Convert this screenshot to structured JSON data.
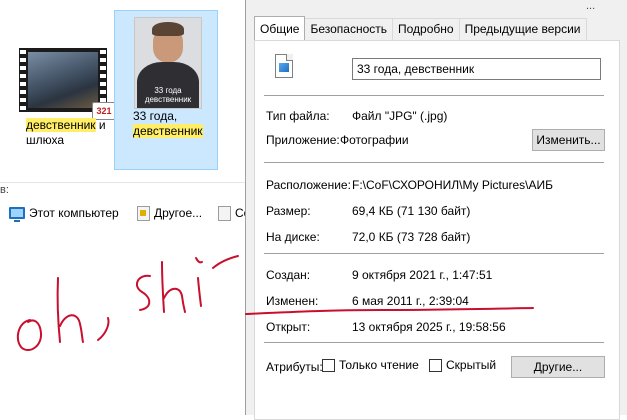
{
  "explorer": {
    "files": [
      {
        "name_hl": "девственник",
        "name_rest": " и шлюха",
        "thumb_icon": "video-file-thumbnail"
      },
      {
        "name_line1": "33 года,",
        "name_hl": "девственник",
        "thumb_caption": "33 года девственник",
        "thumb_icon": "photo-thumbnail"
      }
    ],
    "in_label": "в:",
    "quick_access": [
      "Этот компьютер",
      "Другое...",
      "Co"
    ]
  },
  "dialog": {
    "title_fragment": "...",
    "tabs": [
      "Общие",
      "Безопасность",
      "Подробно",
      "Предыдущие версии"
    ],
    "active_tab": "Общие",
    "file_name": "33 года, девственник",
    "type_label": "Тип файла:",
    "type_value": "Файл \"JPG\" (.jpg)",
    "app_label": "Приложение:",
    "app_value": "Фотографии",
    "change_button": "Изменить...",
    "location_label": "Расположение:",
    "location_value": "F:\\CoF\\СХОРОНИЛ\\My Pictures\\АИБ",
    "size_label": "Размер:",
    "size_value": "69,4 КБ (71 130 байт)",
    "disk_label": "На диске:",
    "disk_value": "72,0 КБ (73 728 байт)",
    "created_label": "Создан:",
    "created_value": "9 октября 2021 г., 1:47:51",
    "modified_label": "Изменен:",
    "modified_value": "6 мая 2011 г., 2:39:04",
    "opened_label": "Открыт:",
    "opened_value": "13 октября 2025 г., 19:58:56",
    "attributes_label": "Атрибуты:",
    "readonly_label": "Только чтение",
    "hidden_label": "Скрытый",
    "other_button": "Другие..."
  },
  "handwriting": "oh, shi-",
  "colors": {
    "ink": "#c8102e",
    "selection": "#cce8ff",
    "highlight": "#ffee66"
  }
}
